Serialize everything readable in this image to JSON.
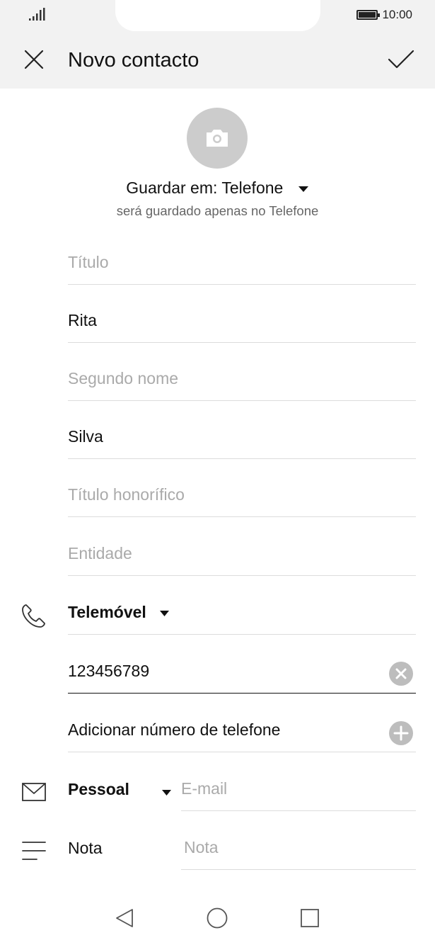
{
  "status_bar": {
    "time": "10:00"
  },
  "header": {
    "title": "Novo contacto"
  },
  "save_target": {
    "label": "Guardar em: Telefone",
    "subtitle": "será guardado apenas no Telefone"
  },
  "fields": {
    "title_placeholder": "Título",
    "first_name_value": "Rita",
    "middle_name_placeholder": "Segundo nome",
    "last_name_value": "Silva",
    "suffix_placeholder": "Título honorífico",
    "company_placeholder": "Entidade"
  },
  "phone": {
    "type_label": "Telemóvel",
    "number_value": "123456789",
    "add_label": "Adicionar número de telefone"
  },
  "email": {
    "type_label": "Pessoal",
    "placeholder": "E-mail"
  },
  "note": {
    "label": "Nota",
    "placeholder": "Nota"
  },
  "icons": {
    "signal": "signal-icon",
    "battery": "battery-icon",
    "close": "close-icon",
    "confirm": "checkmark-icon",
    "camera": "camera-icon",
    "phone": "phone-icon",
    "clear": "clear-icon",
    "add": "add-icon",
    "mail": "mail-icon",
    "note": "note-icon",
    "back": "back-triangle-icon",
    "home": "home-circle-icon",
    "recents": "recents-square-icon"
  }
}
